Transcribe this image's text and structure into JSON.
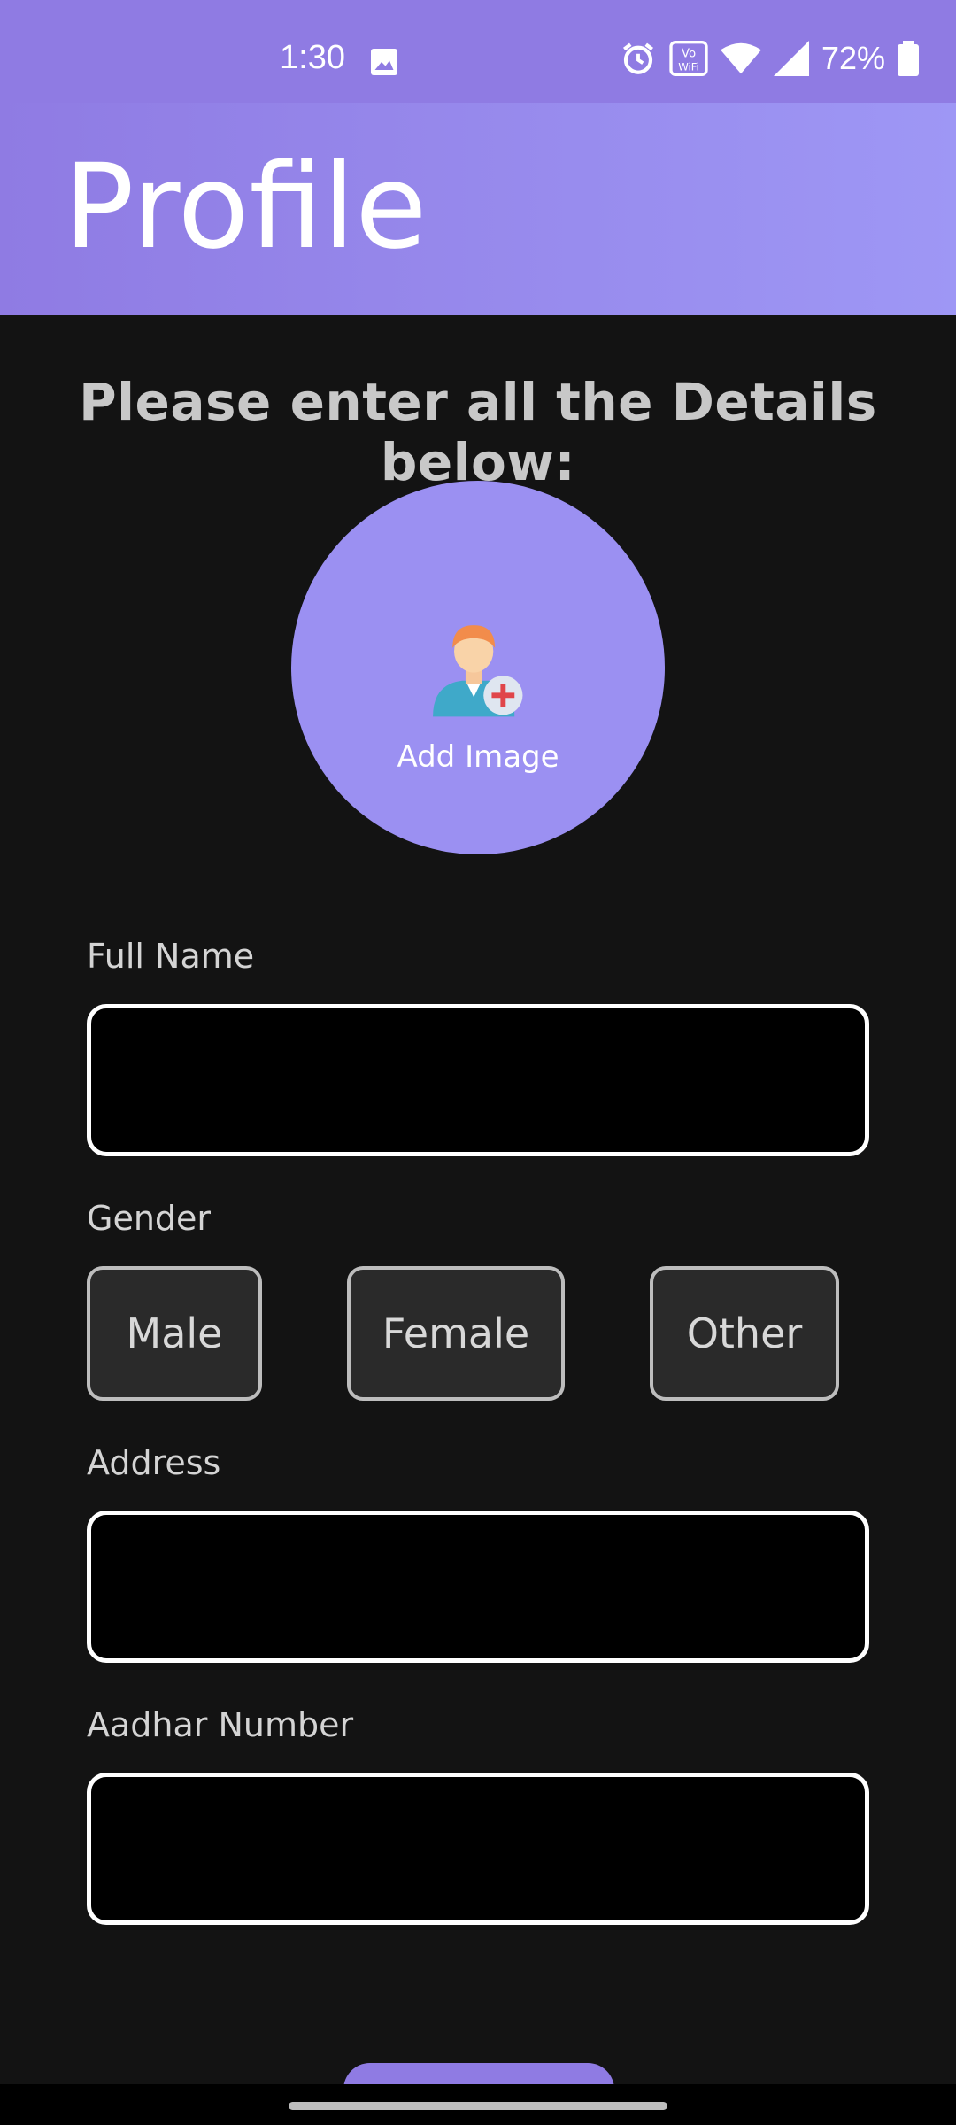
{
  "status_bar": {
    "time": "1:30",
    "battery": "72%",
    "icons": [
      "image-icon",
      "alarm-icon",
      "vowifi-icon",
      "wifi-icon",
      "signal-icon",
      "battery-icon"
    ]
  },
  "app_bar": {
    "title": "Profile"
  },
  "form": {
    "instruction": "Please enter all the Details below:",
    "avatar_label": "Add Image",
    "full_name_label": "Full Name",
    "full_name_value": "",
    "gender_label": "Gender",
    "gender_options": [
      "Male",
      "Female",
      "Other"
    ],
    "address_label": "Address",
    "address_value": "",
    "aadhar_label": "Aadhar Number",
    "aadhar_value": ""
  },
  "colors": {
    "accent": "#8f7be3",
    "avatar_bg": "#9b90f2",
    "background": "#131313"
  }
}
